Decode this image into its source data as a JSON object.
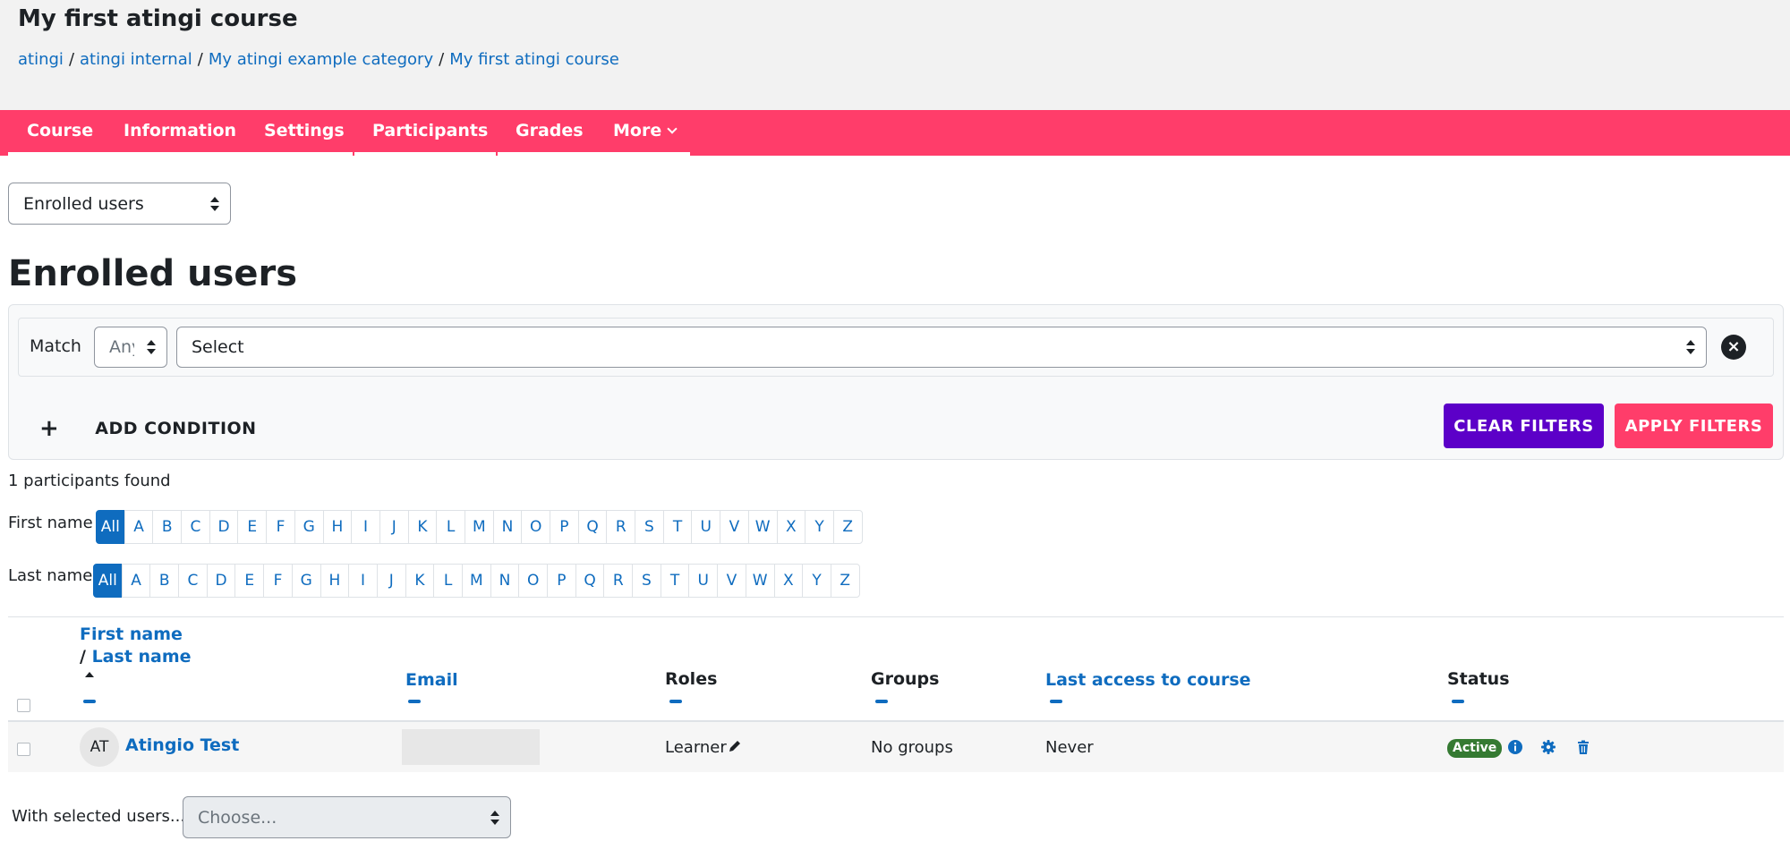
{
  "header": {
    "course_title": "My first atingi course",
    "breadcrumb": [
      "atingi",
      "atingi internal",
      "My atingi example category",
      "My first atingi course"
    ]
  },
  "nav": {
    "items": [
      "Course",
      "Information",
      "Settings",
      "Participants",
      "Grades",
      "More"
    ],
    "active": "Participants"
  },
  "view_select": {
    "value": "Enrolled users"
  },
  "page_heading": "Enrolled users",
  "filters": {
    "match_label": "Match",
    "match_value": "Any",
    "condition_value": "Select",
    "add_condition": "ADD CONDITION",
    "clear_filters": "CLEAR FILTERS",
    "apply_filters": "APPLY FILTERS"
  },
  "participants_found": "1 participants found",
  "initials": {
    "first_name_label": "First name",
    "last_name_label": "Last name",
    "letters": [
      "All",
      "A",
      "B",
      "C",
      "D",
      "E",
      "F",
      "G",
      "H",
      "I",
      "J",
      "K",
      "L",
      "M",
      "N",
      "O",
      "P",
      "Q",
      "R",
      "S",
      "T",
      "U",
      "V",
      "W",
      "X",
      "Y",
      "Z"
    ]
  },
  "table": {
    "headers": {
      "first_name": "First name",
      "slash": "/",
      "last_name": "Last name",
      "email": "Email",
      "roles": "Roles",
      "groups": "Groups",
      "last_access": "Last access to course",
      "status": "Status"
    },
    "rows": [
      {
        "initials": "AT",
        "full_name": "Atingio Test",
        "role": "Learner",
        "groups": "No groups",
        "last_access": "Never",
        "status": "Active"
      }
    ]
  },
  "bulk": {
    "label": "With selected users...",
    "placeholder": "Choose..."
  },
  "colors": {
    "brand_pink": "#ff3d6a",
    "brand_purple": "#5c00c8",
    "link_blue": "#0f6cbf",
    "active_green": "#357a32"
  }
}
